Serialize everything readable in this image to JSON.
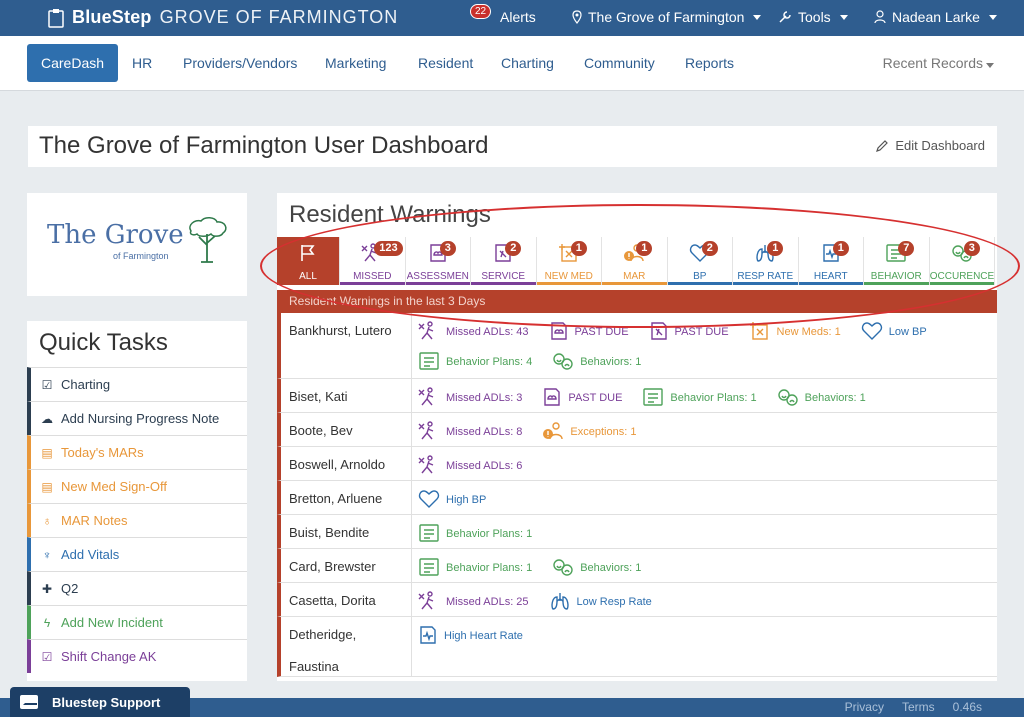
{
  "topbar": {
    "brand": "BlueStep",
    "org": "GROVE OF FARMINGTON",
    "alerts_count": "22",
    "alerts_label": "Alerts",
    "location": "The Grove of Farmington",
    "tools": "Tools",
    "user": "Nadean Larke"
  },
  "nav": {
    "items": [
      "CareDash",
      "HR",
      "Providers/Vendors",
      "Marketing",
      "Resident",
      "Charting",
      "Community",
      "Reports"
    ],
    "recent": "Recent Records"
  },
  "dashboard": {
    "title": "The Grove of Farmington User Dashboard",
    "edit": "Edit Dashboard"
  },
  "logo": {
    "name": "The Grove",
    "sub": "of Farmington"
  },
  "quick_tasks": {
    "title": "Quick Tasks",
    "items": [
      {
        "label": "Charting",
        "icon": "check-square-icon",
        "color": "#2c3e50",
        "glyph": "☑"
      },
      {
        "label": "Add Nursing Progress Note",
        "icon": "cloud-upload-icon",
        "color": "#2c3e50",
        "glyph": "☁"
      },
      {
        "label": "Today's MARs",
        "icon": "medication-icon",
        "color": "#e8973a",
        "glyph": "▤"
      },
      {
        "label": "New Med Sign-Off",
        "icon": "medication-icon",
        "color": "#e8973a",
        "glyph": "▤"
      },
      {
        "label": "MAR Notes",
        "icon": "pill-note-icon",
        "color": "#e8973a",
        "glyph": "♁"
      },
      {
        "label": "Add Vitals",
        "icon": "stethoscope-icon",
        "color": "#2e6fae",
        "glyph": "♆"
      },
      {
        "label": "Q2",
        "icon": "plus-outline-icon",
        "color": "#2c3e50",
        "glyph": "✚"
      },
      {
        "label": "Add New Incident",
        "icon": "lightning-icon",
        "color": "#4ea25a",
        "glyph": "ϟ"
      },
      {
        "label": "Shift Change AK",
        "icon": "check-square-icon",
        "color": "#7b3f98",
        "glyph": "☑"
      }
    ]
  },
  "warnings": {
    "title": "Resident Warnings",
    "subheader": "Resident Warnings in the last 3 Days",
    "tabs": [
      {
        "label": "ALL",
        "count": "",
        "icon": "flag-icon",
        "color": "#b5412b"
      },
      {
        "label": "MISSED",
        "count": "123",
        "icon": "missed-adl-icon",
        "color": "#7b3f98"
      },
      {
        "label": "ASSESSMEN",
        "count": "3",
        "icon": "assessment-icon",
        "color": "#7b3f98"
      },
      {
        "label": "SERVICE",
        "count": "2",
        "icon": "service-icon",
        "color": "#7b3f98"
      },
      {
        "label": "NEW MED",
        "count": "1",
        "icon": "new-med-icon",
        "color": "#e8973a"
      },
      {
        "label": "MAR",
        "count": "1",
        "icon": "mar-icon",
        "color": "#e8973a"
      },
      {
        "label": "BP",
        "count": "2",
        "icon": "heart-icon",
        "color": "#2e6fae"
      },
      {
        "label": "RESP RATE",
        "count": "1",
        "icon": "lungs-icon",
        "color": "#2e6fae"
      },
      {
        "label": "HEART",
        "count": "1",
        "icon": "heart-monitor-icon",
        "color": "#2e6fae"
      },
      {
        "label": "BEHAVIOR",
        "count": "7",
        "icon": "behavior-plan-icon",
        "color": "#4ea25a"
      },
      {
        "label": "OCCURENCE",
        "count": "3",
        "icon": "faces-icon",
        "color": "#4ea25a"
      }
    ],
    "residents": [
      {
        "name": "Bankhurst, Lutero",
        "warnings": [
          {
            "text": "Missed ADLs: 43",
            "kind": "missed"
          },
          {
            "text": "PAST DUE",
            "kind": "assess"
          },
          {
            "text": "PAST DUE",
            "kind": "service"
          },
          {
            "text": "New Meds: 1",
            "kind": "newmed"
          },
          {
            "text": "Low BP",
            "kind": "bp"
          },
          {
            "text": "Behavior Plans: 4",
            "kind": "behaviorplan"
          },
          {
            "text": "Behaviors: 1",
            "kind": "behaviors"
          }
        ]
      },
      {
        "name": "Biset, Kati",
        "warnings": [
          {
            "text": "Missed ADLs: 3",
            "kind": "missed"
          },
          {
            "text": "PAST DUE",
            "kind": "assess"
          },
          {
            "text": "Behavior Plans: 1",
            "kind": "behaviorplan"
          },
          {
            "text": "Behaviors: 1",
            "kind": "behaviors"
          }
        ]
      },
      {
        "name": "Boote, Bev",
        "warnings": [
          {
            "text": "Missed ADLs: 8",
            "kind": "missed"
          },
          {
            "text": "Exceptions: 1",
            "kind": "exception"
          }
        ]
      },
      {
        "name": "Boswell, Arnoldo",
        "warnings": [
          {
            "text": "Missed ADLs: 6",
            "kind": "missed"
          }
        ]
      },
      {
        "name": "Bretton, Arluene",
        "warnings": [
          {
            "text": "High BP",
            "kind": "bp"
          }
        ]
      },
      {
        "name": "Buist, Bendite",
        "warnings": [
          {
            "text": "Behavior Plans: 1",
            "kind": "behaviorplan"
          }
        ]
      },
      {
        "name": "Card, Brewster",
        "warnings": [
          {
            "text": "Behavior Plans: 1",
            "kind": "behaviorplan"
          },
          {
            "text": "Behaviors: 1",
            "kind": "behaviors"
          }
        ]
      },
      {
        "name": "Casetta, Dorita",
        "warnings": [
          {
            "text": "Missed ADLs: 25",
            "kind": "missed"
          },
          {
            "text": "Low Resp Rate",
            "kind": "resp"
          }
        ]
      },
      {
        "name": "Detheridge, Faustina",
        "warnings": [
          {
            "text": "High Heart Rate",
            "kind": "heart"
          }
        ]
      }
    ]
  },
  "footer": {
    "support": "Bluestep Support",
    "links": [
      "Privacy",
      "Terms",
      "0.46s"
    ]
  },
  "colors": {
    "accent": "#2f5d8f",
    "warning": "#b5412b"
  }
}
